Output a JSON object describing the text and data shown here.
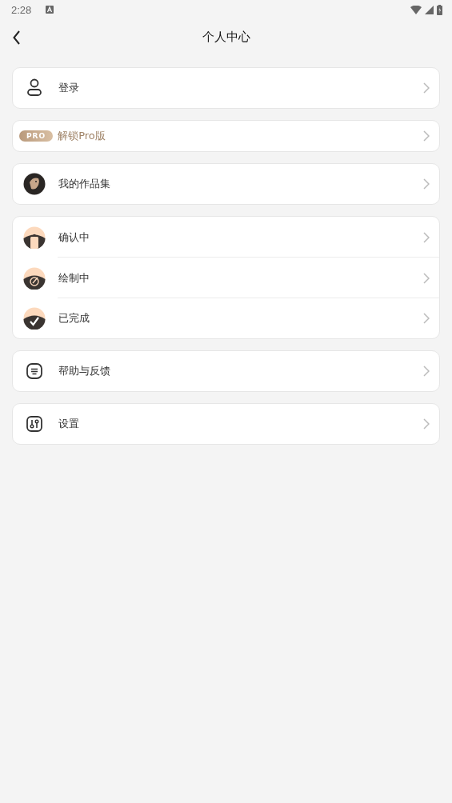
{
  "status_bar": {
    "time": "2:28"
  },
  "header": {
    "title": "个人中心"
  },
  "groups": [
    {
      "items": [
        {
          "kind": "user",
          "label": "登录"
        }
      ]
    },
    {
      "items": [
        {
          "kind": "pro",
          "badge": "PRO",
          "label": "解锁Pro版"
        }
      ]
    },
    {
      "items": [
        {
          "kind": "gallery",
          "label": "我的作品集"
        }
      ]
    },
    {
      "items": [
        {
          "kind": "confirming",
          "label": "确认中"
        },
        {
          "kind": "drawing",
          "label": "绘制中"
        },
        {
          "kind": "done",
          "label": "已完成"
        }
      ]
    },
    {
      "items": [
        {
          "kind": "help",
          "label": "帮助与反馈"
        }
      ]
    },
    {
      "items": [
        {
          "kind": "settings",
          "label": "设置"
        }
      ]
    }
  ]
}
